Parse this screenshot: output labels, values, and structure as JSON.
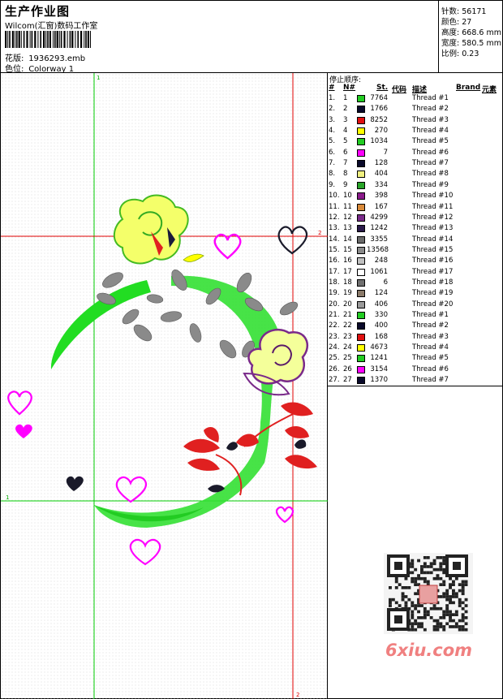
{
  "header": {
    "title": "生产作业图",
    "company": "Wilcom(汇窗)数码工作室",
    "design_label": "花版:",
    "design_file": "1936293.emb",
    "color_label": "色位:",
    "colorway": "Colorway 1"
  },
  "stats": [
    {
      "label": "针数:",
      "value": "56171"
    },
    {
      "label": "颜色:",
      "value": "27"
    },
    {
      "label": "高度:",
      "value": "668.6 mm"
    },
    {
      "label": "宽度:",
      "value": "580.5 mm"
    },
    {
      "label": "比例:",
      "value": "0.23"
    }
  ],
  "table": {
    "caption": "停止顺序:",
    "headers": {
      "idx": "#",
      "n": "N#",
      "st": "St.",
      "code": "代码",
      "desc": "描述",
      "brand": "Brand",
      "elem": "元素"
    },
    "rows": [
      {
        "idx": "1.",
        "n": "1",
        "color": "#22cc22",
        "st": "7764",
        "desc": "Thread #1"
      },
      {
        "idx": "2.",
        "n": "2",
        "color": "#0a0a2a",
        "st": "1766",
        "desc": "Thread #2"
      },
      {
        "idx": "3.",
        "n": "3",
        "color": "#e01010",
        "st": "8252",
        "desc": "Thread #3"
      },
      {
        "idx": "4.",
        "n": "4",
        "color": "#ffff00",
        "st": "270",
        "desc": "Thread #4"
      },
      {
        "idx": "5.",
        "n": "5",
        "color": "#22cc22",
        "st": "1034",
        "desc": "Thread #5"
      },
      {
        "idx": "6.",
        "n": "6",
        "color": "#ff00ff",
        "st": "7",
        "desc": "Thread #6"
      },
      {
        "idx": "7.",
        "n": "7",
        "color": "#0a0a2a",
        "st": "128",
        "desc": "Thread #7"
      },
      {
        "idx": "8.",
        "n": "8",
        "color": "#f0f080",
        "st": "404",
        "desc": "Thread #8"
      },
      {
        "idx": "9.",
        "n": "9",
        "color": "#28a428",
        "st": "334",
        "desc": "Thread #9"
      },
      {
        "idx": "10.",
        "n": "10",
        "color": "#8a1a8a",
        "st": "398",
        "desc": "Thread #10"
      },
      {
        "idx": "11.",
        "n": "11",
        "color": "#d98a3a",
        "st": "167",
        "desc": "Thread #11"
      },
      {
        "idx": "12.",
        "n": "12",
        "color": "#7a2a8a",
        "st": "4299",
        "desc": "Thread #12"
      },
      {
        "idx": "13.",
        "n": "13",
        "color": "#2a1a4a",
        "st": "1242",
        "desc": "Thread #13"
      },
      {
        "idx": "14.",
        "n": "14",
        "color": "#6a6a6a",
        "st": "3355",
        "desc": "Thread #14"
      },
      {
        "idx": "15.",
        "n": "15",
        "color": "#8a8a8a",
        "st": "13568",
        "desc": "Thread #15"
      },
      {
        "idx": "16.",
        "n": "16",
        "color": "#c0c0c0",
        "st": "248",
        "desc": "Thread #16"
      },
      {
        "idx": "17.",
        "n": "17",
        "color": "#ffffff",
        "st": "1061",
        "desc": "Thread #17"
      },
      {
        "idx": "18.",
        "n": "18",
        "color": "#707070",
        "st": "6",
        "desc": "Thread #18"
      },
      {
        "idx": "19.",
        "n": "19",
        "color": "#8a7a6a",
        "st": "124",
        "desc": "Thread #19"
      },
      {
        "idx": "20.",
        "n": "20",
        "color": "#9a9a9a",
        "st": "406",
        "desc": "Thread #20"
      },
      {
        "idx": "21.",
        "n": "21",
        "color": "#22cc22",
        "st": "330",
        "desc": "Thread #1"
      },
      {
        "idx": "22.",
        "n": "22",
        "color": "#0a0a2a",
        "st": "400",
        "desc": "Thread #2"
      },
      {
        "idx": "23.",
        "n": "23",
        "color": "#e01010",
        "st": "168",
        "desc": "Thread #3"
      },
      {
        "idx": "24.",
        "n": "24",
        "color": "#ffff00",
        "st": "4673",
        "desc": "Thread #4"
      },
      {
        "idx": "25.",
        "n": "25",
        "color": "#22cc22",
        "st": "1241",
        "desc": "Thread #5"
      },
      {
        "idx": "26.",
        "n": "26",
        "color": "#ff00ff",
        "st": "3154",
        "desc": "Thread #6"
      },
      {
        "idx": "27.",
        "n": "27",
        "color": "#0a0a2a",
        "st": "1370",
        "desc": "Thread #7"
      }
    ]
  },
  "design": {
    "guide_v_color": "#00cc00",
    "guide_h_color": "#e00000",
    "guide_labels": {
      "top": "1",
      "left": "1",
      "right": "2",
      "bottom": "2"
    }
  },
  "watermark": {
    "brand": "6xiu.com",
    "seal_text": "绣花"
  }
}
